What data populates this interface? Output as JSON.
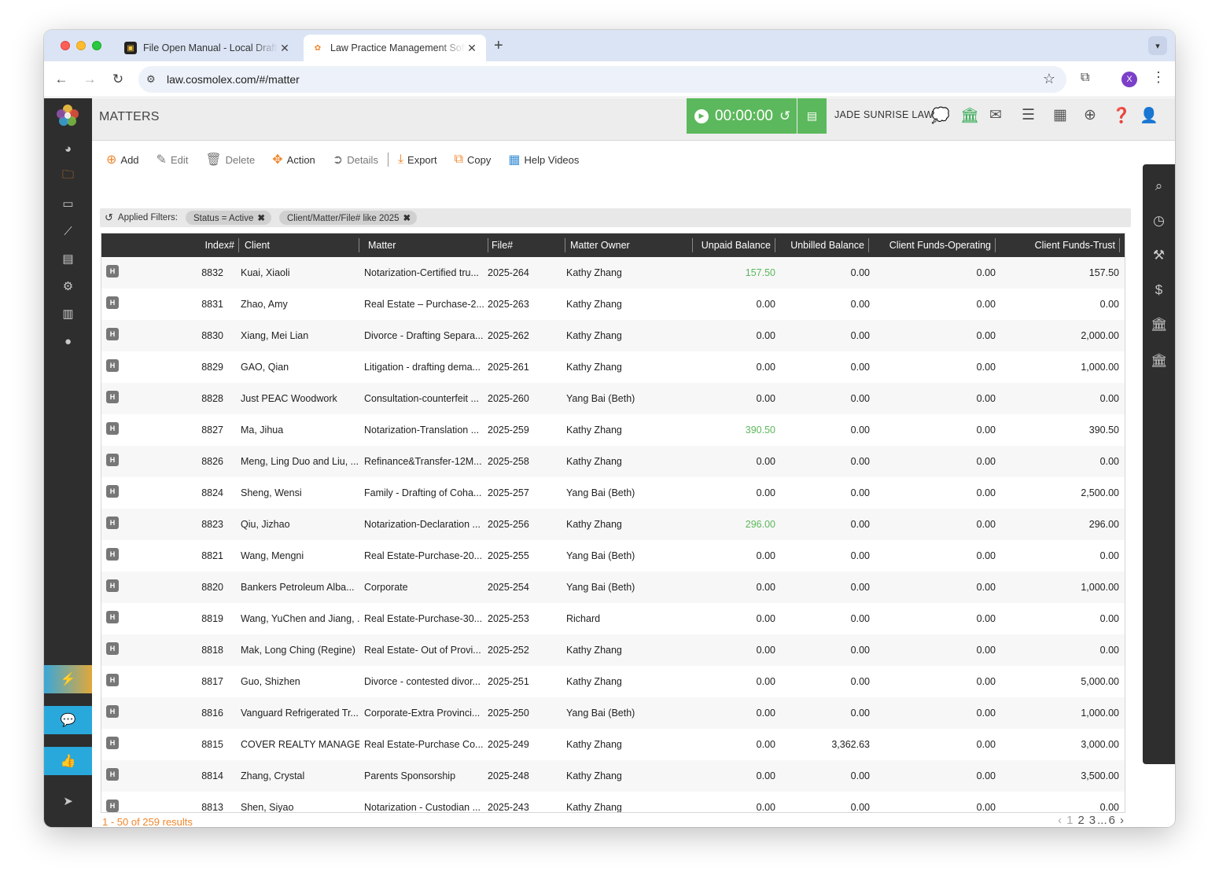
{
  "browser": {
    "tabs": [
      {
        "title": "File Open Manual - Local Draft",
        "favicon": "document-favicon"
      },
      {
        "title": "Law Practice Management Software",
        "favicon": "cosmolex-favicon"
      }
    ],
    "url": "law.cosmolex.com/#/matter",
    "profile_initial": "X"
  },
  "header": {
    "page_title": "MATTERS",
    "timer_value": "00:00:00",
    "firm_name": "JADE SUNRISE LAW"
  },
  "actions": {
    "add": "Add",
    "edit": "Edit",
    "delete": "Delete",
    "action": "Action",
    "details": "Details",
    "export": "Export",
    "copy": "Copy",
    "help_videos": "Help Videos"
  },
  "filters": {
    "label": "Applied Filters:",
    "chips": [
      "Status = Active",
      "Client/Matter/File# like 2025"
    ]
  },
  "table": {
    "columns": [
      "Index#",
      "Client",
      "Matter",
      "File#",
      "Matter Owner",
      "Unpaid Balance",
      "Unbilled Balance",
      "Client Funds-Operating",
      "Client Funds-Trust"
    ],
    "row_badge": "H",
    "rows": [
      {
        "index": "8832",
        "client": "Kuai, Xiaoli",
        "matter": "Notarization-Certified tru...",
        "file": "2025-264",
        "owner": "Kathy Zhang",
        "unpaid": "157.50",
        "unbilled": "0.00",
        "operating": "0.00",
        "trust": "157.50",
        "unpaid_green": true
      },
      {
        "index": "8831",
        "client": "Zhao, Amy",
        "matter": "Real Estate – Purchase-2...",
        "file": "2025-263",
        "owner": "Kathy Zhang",
        "unpaid": "0.00",
        "unbilled": "0.00",
        "operating": "0.00",
        "trust": "0.00",
        "unpaid_green": false
      },
      {
        "index": "8830",
        "client": "Xiang, Mei Lian",
        "matter": "Divorce - Drafting Separa...",
        "file": "2025-262",
        "owner": "Kathy Zhang",
        "unpaid": "0.00",
        "unbilled": "0.00",
        "operating": "0.00",
        "trust": "2,000.00",
        "unpaid_green": false
      },
      {
        "index": "8829",
        "client": "GAO, Qian",
        "matter": "Litigation - drafting dema...",
        "file": "2025-261",
        "owner": "Kathy Zhang",
        "unpaid": "0.00",
        "unbilled": "0.00",
        "operating": "0.00",
        "trust": "1,000.00",
        "unpaid_green": false
      },
      {
        "index": "8828",
        "client": "Just PEAC Woodwork",
        "matter": "Consultation-counterfeit ...",
        "file": "2025-260",
        "owner": "Yang Bai (Beth)",
        "unpaid": "0.00",
        "unbilled": "0.00",
        "operating": "0.00",
        "trust": "0.00",
        "unpaid_green": false
      },
      {
        "index": "8827",
        "client": "Ma, Jihua",
        "matter": "Notarization-Translation ...",
        "file": "2025-259",
        "owner": "Kathy Zhang",
        "unpaid": "390.50",
        "unbilled": "0.00",
        "operating": "0.00",
        "trust": "390.50",
        "unpaid_green": true
      },
      {
        "index": "8826",
        "client": "Meng, Ling Duo and Liu, ...",
        "matter": "Refinance&Transfer-12M...",
        "file": "2025-258",
        "owner": "Kathy Zhang",
        "unpaid": "0.00",
        "unbilled": "0.00",
        "operating": "0.00",
        "trust": "0.00",
        "unpaid_green": false
      },
      {
        "index": "8824",
        "client": "Sheng, Wensi",
        "matter": "Family - Drafting of Coha...",
        "file": "2025-257",
        "owner": "Yang Bai (Beth)",
        "unpaid": "0.00",
        "unbilled": "0.00",
        "operating": "0.00",
        "trust": "2,500.00",
        "unpaid_green": false
      },
      {
        "index": "8823",
        "client": "Qiu, Jizhao",
        "matter": "Notarization-Declaration ...",
        "file": "2025-256",
        "owner": "Kathy Zhang",
        "unpaid": "296.00",
        "unbilled": "0.00",
        "operating": "0.00",
        "trust": "296.00",
        "unpaid_green": true
      },
      {
        "index": "8821",
        "client": "Wang, Mengni",
        "matter": "Real Estate-Purchase-20...",
        "file": "2025-255",
        "owner": "Yang Bai (Beth)",
        "unpaid": "0.00",
        "unbilled": "0.00",
        "operating": "0.00",
        "trust": "0.00",
        "unpaid_green": false
      },
      {
        "index": "8820",
        "client": "Bankers Petroleum Alba...",
        "matter": "Corporate",
        "file": "2025-254",
        "owner": "Yang Bai (Beth)",
        "unpaid": "0.00",
        "unbilled": "0.00",
        "operating": "0.00",
        "trust": "1,000.00",
        "unpaid_green": false
      },
      {
        "index": "8819",
        "client": "Wang, YuChen and Jiang, ...",
        "matter": "Real Estate-Purchase-30...",
        "file": "2025-253",
        "owner": "Richard",
        "unpaid": "0.00",
        "unbilled": "0.00",
        "operating": "0.00",
        "trust": "0.00",
        "unpaid_green": false
      },
      {
        "index": "8818",
        "client": "Mak, Long Ching (Regine)",
        "matter": "Real Estate- Out of Provi...",
        "file": "2025-252",
        "owner": "Kathy Zhang",
        "unpaid": "0.00",
        "unbilled": "0.00",
        "operating": "0.00",
        "trust": "0.00",
        "unpaid_green": false
      },
      {
        "index": "8817",
        "client": "Guo, Shizhen",
        "matter": "Divorce - contested divor...",
        "file": "2025-251",
        "owner": "Kathy Zhang",
        "unpaid": "0.00",
        "unbilled": "0.00",
        "operating": "0.00",
        "trust": "5,000.00",
        "unpaid_green": false
      },
      {
        "index": "8816",
        "client": "Vanguard Refrigerated Tr...",
        "matter": "Corporate-Extra Provinci...",
        "file": "2025-250",
        "owner": "Yang Bai (Beth)",
        "unpaid": "0.00",
        "unbilled": "0.00",
        "operating": "0.00",
        "trust": "1,000.00",
        "unpaid_green": false
      },
      {
        "index": "8815",
        "client": "COVER REALTY MANAGE...",
        "matter": "Real Estate-Purchase Co...",
        "file": "2025-249",
        "owner": "Kathy Zhang",
        "unpaid": "0.00",
        "unbilled": "3,362.63",
        "operating": "0.00",
        "trust": "3,000.00",
        "unpaid_green": false
      },
      {
        "index": "8814",
        "client": "Zhang, Crystal",
        "matter": "Parents Sponsorship",
        "file": "2025-248",
        "owner": "Kathy Zhang",
        "unpaid": "0.00",
        "unbilled": "0.00",
        "operating": "0.00",
        "trust": "3,500.00",
        "unpaid_green": false
      },
      {
        "index": "8813",
        "client": "Shen, Siyao",
        "matter": "Notarization - Custodian ...",
        "file": "2025-243",
        "owner": "Kathy Zhang",
        "unpaid": "0.00",
        "unbilled": "0.00",
        "operating": "0.00",
        "trust": "0.00",
        "unpaid_green": false
      }
    ]
  },
  "footer": {
    "results": "1 - 50 of 259 results",
    "pages": [
      "1",
      "2",
      "3",
      "...",
      "6"
    ]
  },
  "colors": {
    "accent_orange": "#f0862b",
    "timer_green": "#5cb85c",
    "sidebar_bg": "#2e2e2e"
  }
}
